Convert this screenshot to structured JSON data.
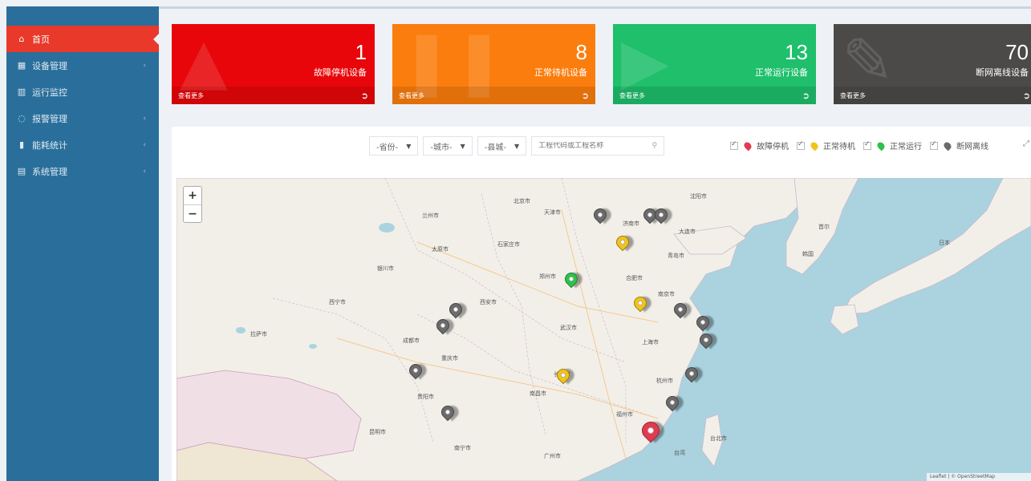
{
  "sidebar": {
    "items": [
      {
        "label": "首页",
        "icon": "home-icon",
        "glyph": "⌂",
        "active": true,
        "chevron": false
      },
      {
        "label": "设备管理",
        "icon": "device-icon",
        "glyph": "▦",
        "active": false,
        "chevron": true
      },
      {
        "label": "运行监控",
        "icon": "monitor-icon",
        "glyph": "▥",
        "active": false,
        "chevron": false
      },
      {
        "label": "报警管理",
        "icon": "location-icon",
        "glyph": "◌",
        "active": false,
        "chevron": true
      },
      {
        "label": "能耗统计",
        "icon": "bar-chart-icon",
        "glyph": "▮",
        "active": false,
        "chevron": true
      },
      {
        "label": "系统管理",
        "icon": "grid-icon",
        "glyph": "▤",
        "active": false,
        "chevron": true
      }
    ],
    "chevron_glyph": "‹"
  },
  "cards": [
    {
      "count": "1",
      "label": "故障停机设备",
      "more": "查看更多",
      "color": "#e8060a",
      "icon": "warning-icon"
    },
    {
      "count": "8",
      "label": "正常待机设备",
      "more": "查看更多",
      "color": "#fb7d0d",
      "icon": "pause-icon"
    },
    {
      "count": "13",
      "label": "正常运行设备",
      "more": "查看更多",
      "color": "#1fbf6b",
      "icon": "play-icon"
    },
    {
      "count": "70",
      "label": "断网离线设备",
      "more": "查看更多",
      "color": "#4b4a48",
      "icon": "wrench-icon"
    }
  ],
  "filters": {
    "province": "-省份-",
    "city": "-城市-",
    "district": "-县城-",
    "search_placeholder": "工程代码或工程名称"
  },
  "legend": [
    {
      "label": "故障停机",
      "color": "#e23a4f"
    },
    {
      "label": "正常待机",
      "color": "#f2c31a"
    },
    {
      "label": "正常运行",
      "color": "#2ec24a"
    },
    {
      "label": "断网离线",
      "color": "#6b6b6b"
    }
  ],
  "map": {
    "zoom_in": "+",
    "zoom_out": "−",
    "attribution": "Leaflet | © OpenStreetMap",
    "labels": [
      "北京市",
      "天津市",
      "石家庄市",
      "太原市",
      "济南市",
      "郑州市",
      "西安市",
      "武汉市",
      "南京市",
      "上海市",
      "杭州市",
      "合肥市",
      "长沙市",
      "南昌市",
      "福州市",
      "重庆市",
      "成都市",
      "贵阳市",
      "昆明市",
      "南宁市",
      "广州市",
      "台北市",
      "兰州市",
      "银川市",
      "西宁市",
      "拉萨市",
      "青岛市",
      "沈阳市",
      "大连市",
      "首尔",
      "日本",
      "韩国",
      "台湾"
    ]
  }
}
